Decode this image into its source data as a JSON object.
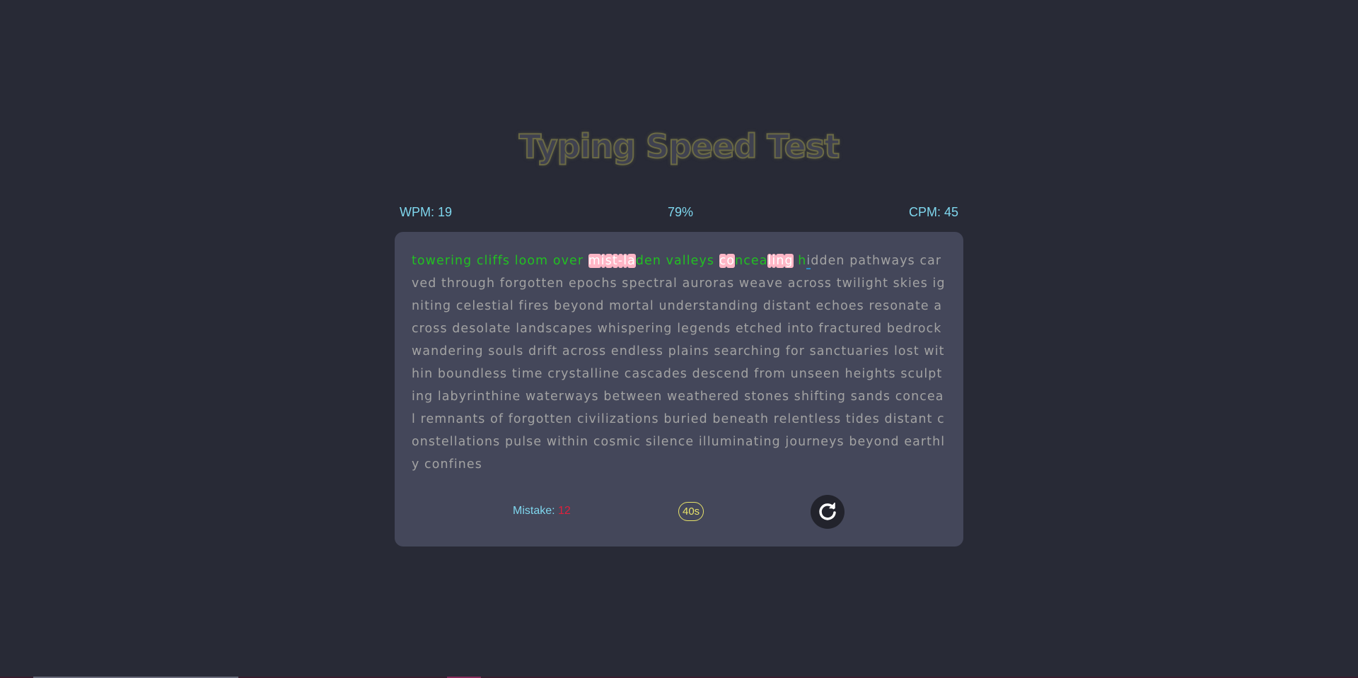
{
  "app": {
    "title": "Typing Speed Test"
  },
  "stats": {
    "wpm_label": "WPM: 19",
    "accuracy": "79%",
    "cpm_label": "CPM: 45"
  },
  "passage": {
    "text": "towering cliffs loom over mist-laden valleys concealing hidden pathways carved through forgotten epochs spectral auroras weave across twilight skies igniting celestial fires beyond mortal understanding distant echoes resonate across desolate landscapes whispering legends etched into fractured bedrock wandering souls drift across endless plains searching for sanctuaries lost within boundless time crystalline cascades descend from unseen heights sculpting labyrinthine waterways between weathered stones shifting sands conceal remnants of forgotten civilizations buried beneath relentless tides distant constellations pulse within cosmic silence illuminating journeys beyond earthly confines",
    "typed_count": 57,
    "wrong_indices": [
      26,
      27,
      28,
      29,
      30,
      31,
      32,
      45,
      46,
      51,
      52,
      53,
      54
    ],
    "active_index": 57
  },
  "footer": {
    "mistake_label": "Mistake:",
    "mistake_count": "12",
    "timer": "40s",
    "reset_icon": "refresh-icon"
  },
  "colors": {
    "background": "#282a36",
    "card": "#44475a",
    "correct": "#22c022",
    "wrong_bg": "#ffb6c6",
    "pending": "#a3a3a3",
    "accent": "#7fd7ee",
    "timer": "#e8e36a",
    "mistake_count": "#e0203c"
  }
}
